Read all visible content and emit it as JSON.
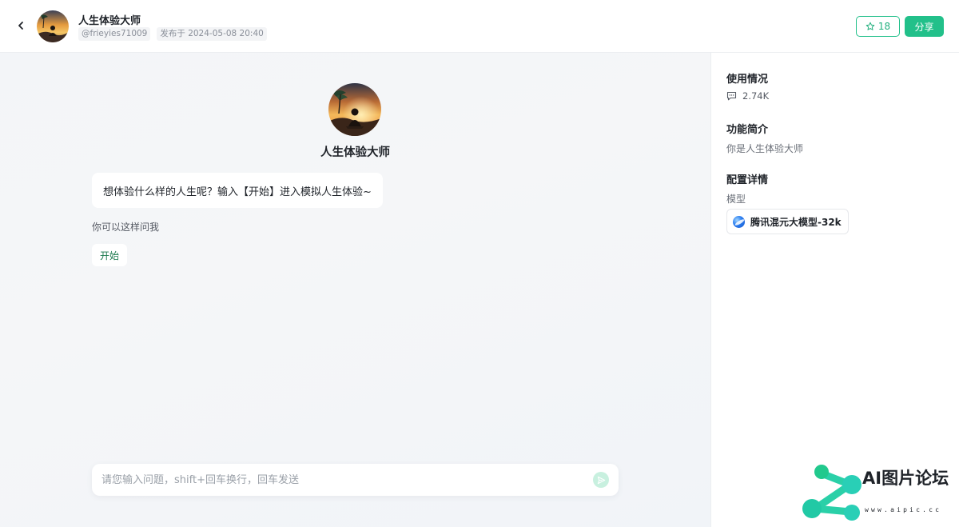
{
  "header": {
    "title": "人生体验大师",
    "author": "@frieyies71009",
    "published": "发布于 2024-05-08 20:40",
    "star_count": "18",
    "share_label": "分享"
  },
  "bot": {
    "name": "人生体验大师",
    "greeting": "想体验什么样的人生呢？输入【开始】进入模拟人生体验~",
    "hint_label": "你可以这样问我",
    "suggestions": [
      "开始"
    ]
  },
  "input": {
    "placeholder": "请您输入问题，shift+回车换行，回车发送",
    "value": ""
  },
  "sidebar": {
    "usage_heading": "使用情况",
    "usage_count": "2.74K",
    "intro_heading": "功能简介",
    "intro_text": "你是人生体验大师",
    "config_heading": "配置详情",
    "model_label": "模型",
    "model_name": "腾讯混元大模型-32k"
  },
  "watermark": {
    "text": "AI图片论坛",
    "url": "www.aipic.cc"
  },
  "colors": {
    "accent": "#22c08a",
    "watermark_green": "#21c98d",
    "watermark_teal": "#29cfb6"
  },
  "icons": {
    "back": "chevron-left-icon",
    "star": "star-outline-icon",
    "usage": "chat-bubble-icon",
    "send": "send-icon"
  }
}
